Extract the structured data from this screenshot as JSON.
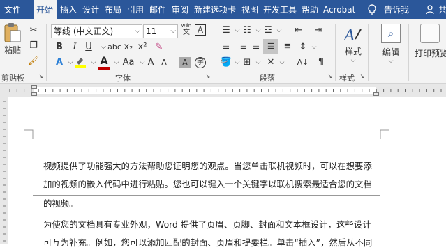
{
  "tabs": {
    "file": "文件",
    "home": "开始",
    "insert": "插入",
    "design": "设计",
    "layout": "布局",
    "references": "引用",
    "mailings": "邮件",
    "review": "审阅",
    "new_tab": "新建选项卡",
    "view": "视图",
    "developer": "开发工具",
    "help": "帮助",
    "acrobat": "Acrobat",
    "tell_me": "告诉我",
    "share": "共"
  },
  "clipboard": {
    "paste_label": "粘贴",
    "group_label": "剪贴板"
  },
  "font": {
    "font_name": "等线 (中文正文)",
    "font_size": "11",
    "wen_glyph": "wén",
    "wen_char": "文",
    "bold": "B",
    "italic": "I",
    "underline": "U",
    "strike": "abc",
    "subscript": "x₂",
    "superscript": "x²",
    "case": "Aa",
    "grow": "A",
    "shrink": "A",
    "group_label": "字体"
  },
  "paragraph": {
    "group_label": "段落"
  },
  "styles": {
    "label": "样式",
    "group_label": "样式"
  },
  "editing": {
    "label": "编辑"
  },
  "print_preview": {
    "label": "打印预览"
  },
  "document": {
    "p1_line1": "视频提供了功能强大的方法帮助您证明您的观点。当您单击联机视频时，可以在想要添",
    "p1_line2": "加的视频的嵌入代码中进行粘贴。您也可以键入一个关键字以联机搜索最适合您的文档",
    "p1_line3": "的视频。",
    "p2_line1": "为使您的文档具有专业外观，Word 提供了页眉、页脚、封面和文本框设计，这些设计",
    "p2_line2": "可互为补充。例如，您可以添加匹配的封面、页眉和提要栏。单击“插入”，然后从不同"
  },
  "colors": {
    "accent": "#2b579a",
    "highlight": "#ffff00",
    "font_color": "#c00000"
  }
}
